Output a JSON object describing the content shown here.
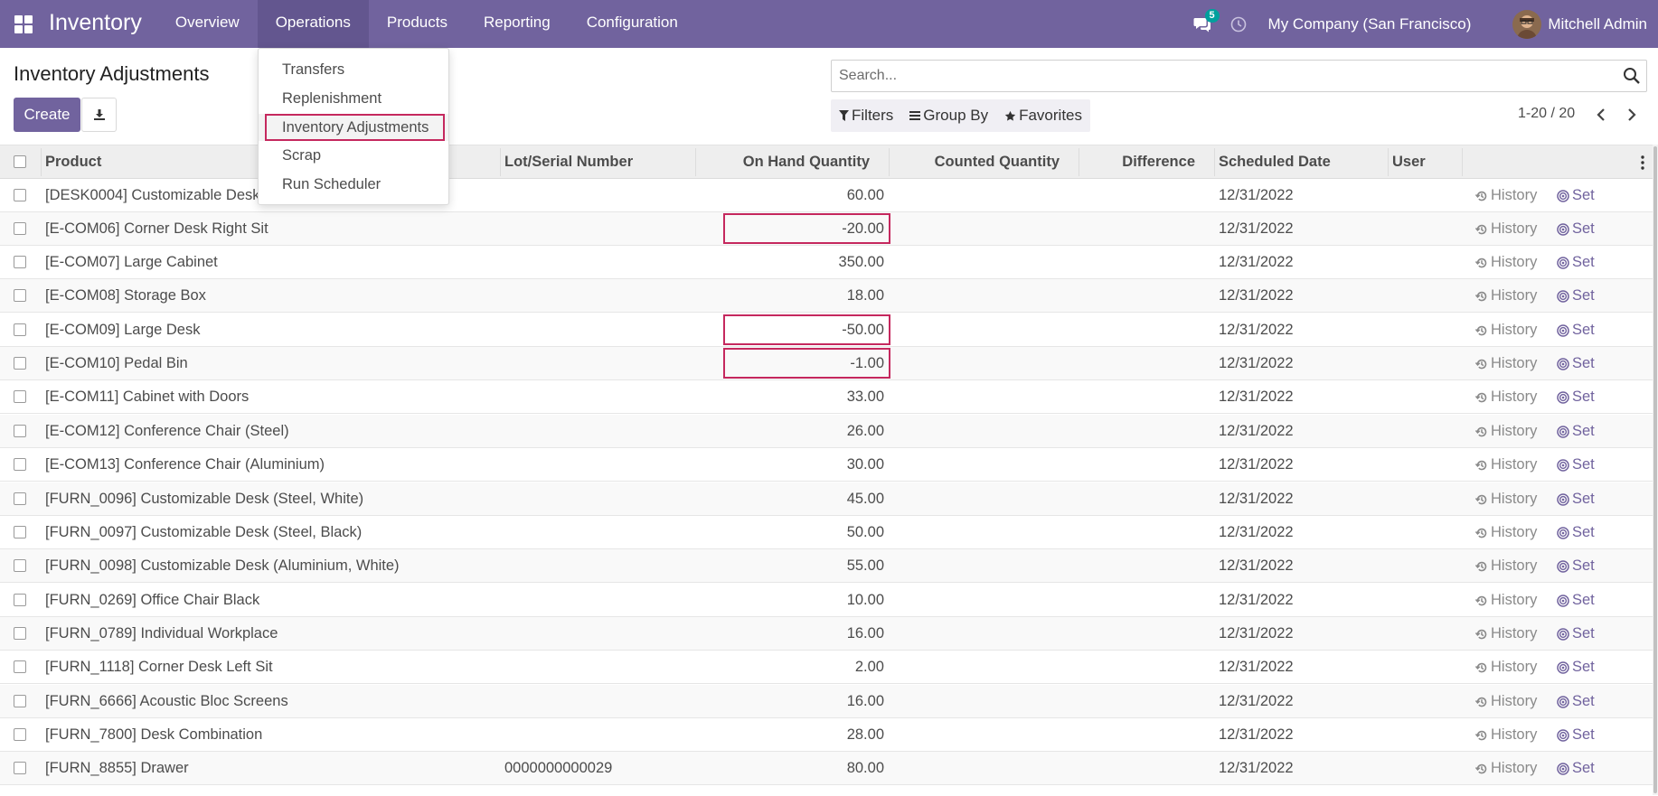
{
  "navbar": {
    "app_title": "Inventory",
    "menus": [
      "Overview",
      "Operations",
      "Products",
      "Reporting",
      "Configuration"
    ],
    "active_menu": "Operations",
    "message_count": "5",
    "company": "My Company (San Francisco)",
    "user": "Mitchell Admin",
    "colors": {
      "brand": "#71639e",
      "badge": "#00a09d",
      "highlight": "#c5285e"
    }
  },
  "operations_menu": {
    "items": [
      "Transfers",
      "Replenishment",
      "Inventory Adjustments",
      "Scrap",
      "Run Scheduler"
    ],
    "highlighted": "Inventory Adjustments"
  },
  "control_panel": {
    "page_title": "Inventory Adjustments",
    "create_label": "Create",
    "search_placeholder": "Search...",
    "filters_label": "Filters",
    "group_by_label": "Group By",
    "favorites_label": "Favorites",
    "pager": "1-20 / 20"
  },
  "table": {
    "columns": [
      "Product",
      "Lot/Serial Number",
      "On Hand Quantity",
      "Counted Quantity",
      "Difference",
      "Scheduled Date",
      "User"
    ],
    "history_label": "History",
    "set_label": "Set",
    "rows": [
      {
        "product": "[DESK0004] Customizable Desk",
        "lot": "",
        "on_hand": "60.00",
        "date": "12/31/2022",
        "highlight": false
      },
      {
        "product": "[E-COM06] Corner Desk Right Sit",
        "lot": "",
        "on_hand": "-20.00",
        "date": "12/31/2022",
        "highlight": true
      },
      {
        "product": "[E-COM07] Large Cabinet",
        "lot": "",
        "on_hand": "350.00",
        "date": "12/31/2022",
        "highlight": false
      },
      {
        "product": "[E-COM08] Storage Box",
        "lot": "",
        "on_hand": "18.00",
        "date": "12/31/2022",
        "highlight": false
      },
      {
        "product": "[E-COM09] Large Desk",
        "lot": "",
        "on_hand": "-50.00",
        "date": "12/31/2022",
        "highlight": true
      },
      {
        "product": "[E-COM10] Pedal Bin",
        "lot": "",
        "on_hand": "-1.00",
        "date": "12/31/2022",
        "highlight": true
      },
      {
        "product": "[E-COM11] Cabinet with Doors",
        "lot": "",
        "on_hand": "33.00",
        "date": "12/31/2022",
        "highlight": false
      },
      {
        "product": "[E-COM12] Conference Chair (Steel)",
        "lot": "",
        "on_hand": "26.00",
        "date": "12/31/2022",
        "highlight": false
      },
      {
        "product": "[E-COM13] Conference Chair (Aluminium)",
        "lot": "",
        "on_hand": "30.00",
        "date": "12/31/2022",
        "highlight": false
      },
      {
        "product": "[FURN_0096] Customizable Desk (Steel, White)",
        "lot": "",
        "on_hand": "45.00",
        "date": "12/31/2022",
        "highlight": false
      },
      {
        "product": "[FURN_0097] Customizable Desk (Steel, Black)",
        "lot": "",
        "on_hand": "50.00",
        "date": "12/31/2022",
        "highlight": false
      },
      {
        "product": "[FURN_0098] Customizable Desk (Aluminium, White)",
        "lot": "",
        "on_hand": "55.00",
        "date": "12/31/2022",
        "highlight": false
      },
      {
        "product": "[FURN_0269] Office Chair Black",
        "lot": "",
        "on_hand": "10.00",
        "date": "12/31/2022",
        "highlight": false
      },
      {
        "product": "[FURN_0789] Individual Workplace",
        "lot": "",
        "on_hand": "16.00",
        "date": "12/31/2022",
        "highlight": false
      },
      {
        "product": "[FURN_1118] Corner Desk Left Sit",
        "lot": "",
        "on_hand": "2.00",
        "date": "12/31/2022",
        "highlight": false
      },
      {
        "product": "[FURN_6666] Acoustic Bloc Screens",
        "lot": "",
        "on_hand": "16.00",
        "date": "12/31/2022",
        "highlight": false
      },
      {
        "product": "[FURN_7800] Desk Combination",
        "lot": "",
        "on_hand": "28.00",
        "date": "12/31/2022",
        "highlight": false
      },
      {
        "product": "[FURN_8855] Drawer",
        "lot": "0000000000029",
        "on_hand": "80.00",
        "date": "12/31/2022",
        "highlight": false
      }
    ]
  }
}
